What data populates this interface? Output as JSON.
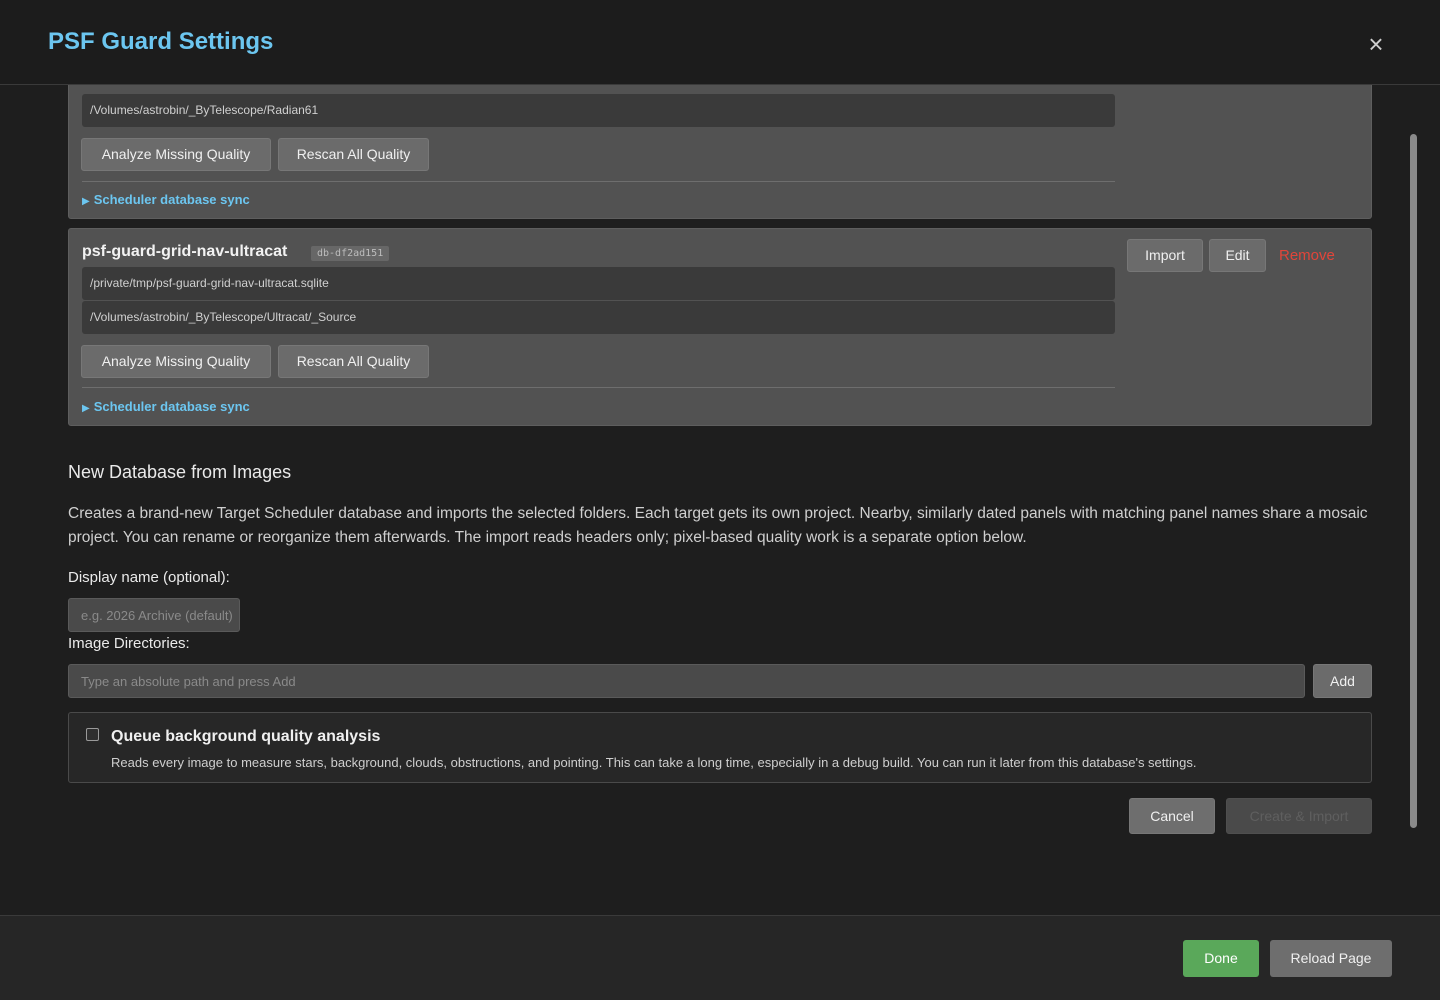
{
  "header": {
    "title": "PSF Guard Settings",
    "close_glyph": "×"
  },
  "card1": {
    "path": "/Volumes/astrobin/_ByTelescope/Radian61",
    "analyze_label": "Analyze Missing Quality",
    "rescan_label": "Rescan All Quality",
    "sync_label": "Scheduler database sync"
  },
  "card2": {
    "name": "psf-guard-grid-nav-ultracat",
    "id": "db-df2ad151",
    "db_path": "/private/tmp/psf-guard-grid-nav-ultracat.sqlite",
    "image_path": "/Volumes/astrobin/_ByTelescope/Ultracat/_Source",
    "analyze_label": "Analyze Missing Quality",
    "rescan_label": "Rescan All Quality",
    "sync_label": "Scheduler database sync",
    "import_label": "Import",
    "edit_label": "Edit",
    "remove_label": "Remove"
  },
  "new_db": {
    "heading": "New Database from Images",
    "description": "Creates a brand-new Target Scheduler database and imports the selected folders. Each target gets its own project. Nearby, similarly dated panels with matching panel names share a mosaic project. You can rename or reorganize them afterwards. The import reads headers only; pixel-based quality work is a separate option below.",
    "display_name_label": "Display name (optional):",
    "display_name_placeholder": "e.g. 2026 Archive (default)",
    "directories_label": "Image Directories:",
    "directories_placeholder": "Type an absolute path and press Add",
    "add_label": "Add",
    "queue_title": "Queue background quality analysis",
    "queue_desc": "Reads every image to measure stars, background, clouds, obstructions, and pointing. This can take a long time, especially in a debug build. You can run it later from this database's settings.",
    "cancel_label": "Cancel",
    "create_label": "Create & Import"
  },
  "footer": {
    "done_label": "Done",
    "reload_label": "Reload Page"
  },
  "colors": {
    "accent": "#6cc6f0",
    "danger": "#e2453a",
    "success": "#5aa85a"
  }
}
